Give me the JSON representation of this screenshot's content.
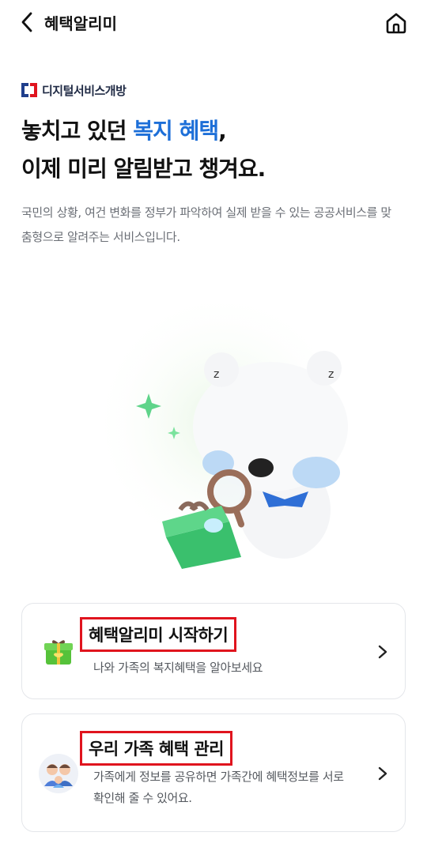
{
  "header": {
    "title": "혜택알리미",
    "back_icon": "chevron-left-icon",
    "home_icon": "home-icon"
  },
  "brand": {
    "name": "디지털서비스개방"
  },
  "headline": {
    "line1_prefix": "놓치고 있던 ",
    "line1_accent": "복지 혜택",
    "line1_suffix": ",",
    "line2": "이제 미리 알림받고 챙겨요."
  },
  "description": "국민의 상황, 여건 변화를 정부가 파악하여 실제 받을 수 있는 공공서비스를 맞춤형으로 알려주는 서비스입니다.",
  "cards": [
    {
      "title": "혜택알리미 시작하기",
      "subtitle": "나와 가족의 복지혜택을 알아보세요",
      "icon": "gift-box-icon"
    },
    {
      "title": "우리 가족 혜택 관리",
      "subtitle": "가족에게 정보를 공유하면 가족간에 혜택정보를 서로 확인해 줄 수 있어요.",
      "icon": "family-icon"
    }
  ],
  "colors": {
    "accent": "#1d6fd8",
    "highlight_box": "#e0141e",
    "muted_text": "#6b6f76"
  }
}
